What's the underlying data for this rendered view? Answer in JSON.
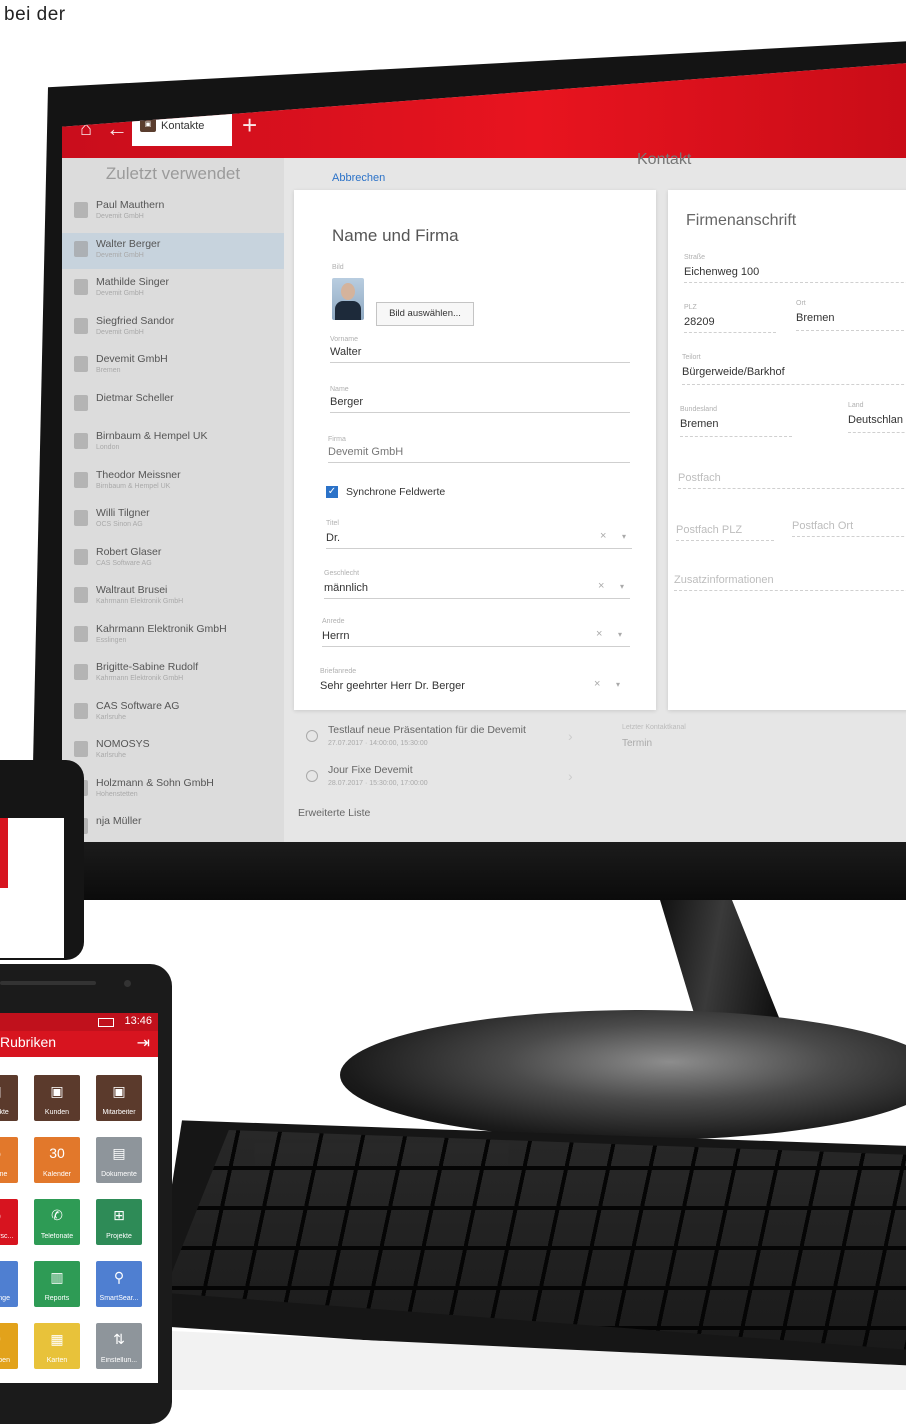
{
  "page_caption": "bei der",
  "app": {
    "tab_label": "Kontakte",
    "plus_label": "+",
    "home_icon": "home-icon",
    "back_icon": "arrow-left-icon",
    "left_title": "Zuletzt verwendet",
    "recent": [
      {
        "name": "Paul Mauthern",
        "sub": "Devemit GmbH"
      },
      {
        "name": "Walter Berger",
        "sub": "Devemit GmbH",
        "selected": true
      },
      {
        "name": "Mathilde Singer",
        "sub": "Devemit GmbH"
      },
      {
        "name": "Siegfried Sandor",
        "sub": "Devemit GmbH"
      },
      {
        "name": "Devemit GmbH",
        "sub": "Bremen"
      },
      {
        "name": "Dietmar Scheller",
        "sub": ""
      },
      {
        "name": "Birnbaum & Hempel UK",
        "sub": "London"
      },
      {
        "name": "Theodor Meissner",
        "sub": "Birnbaum & Hempel UK"
      },
      {
        "name": "Willi Tilgner",
        "sub": "OCS Sinon AG"
      },
      {
        "name": "Robert Glaser",
        "sub": "CAS Software AG"
      },
      {
        "name": "Waltraut Brusei",
        "sub": "Kahrmann Elektronik GmbH"
      },
      {
        "name": "Kahrmann Elektronik GmbH",
        "sub": "Esslingen"
      },
      {
        "name": "Brigitte-Sabine Rudolf",
        "sub": "Kahrmann Elektronik GmbH"
      },
      {
        "name": "CAS Software AG",
        "sub": "Karlsruhe"
      },
      {
        "name": "NOMOSYS",
        "sub": "Karlsruhe"
      },
      {
        "name": "Holzmann & Sohn GmbH",
        "sub": "Hohenstetten"
      },
      {
        "name": "nja Müller",
        "sub": ""
      }
    ],
    "center_title": "Kontakt",
    "cancel_label": "Abbrechen",
    "name_card": {
      "title": "Name und Firma",
      "photo_label": "Bild",
      "photo_button": "Bild auswählen...",
      "firstname_label": "Vorname",
      "firstname": "Walter",
      "lastname_label": "Name",
      "lastname": "Berger",
      "company_label": "Firma",
      "company": "Devemit GmbH",
      "sync_label": "Synchrone Feldwerte",
      "title_label": "Titel",
      "title_value": "Dr.",
      "gender_label": "Geschlecht",
      "gender_value": "männlich",
      "salutation_label": "Anrede",
      "salutation_value": "Herrn",
      "letter_salutation_label": "Briefanrede",
      "letter_salutation_value": "Sehr geehrter Herr Dr. Berger",
      "clear_glyph": "×",
      "dropdown_glyph": "▾"
    },
    "address_card": {
      "title": "Firmenanschrift",
      "street_label": "Straße",
      "street": "Eichenweg 100",
      "zip_label": "PLZ",
      "zip": "28209",
      "city_label": "Ort",
      "city": "Bremen",
      "district_label": "Teilort",
      "district": "Bürgerweide/Barkhof",
      "state_label": "Bundesland",
      "state": "Bremen",
      "country_label": "Land",
      "country": "Deutschlan",
      "pobox_placeholder": "Postfach",
      "pobox_zip_placeholder": "Postfach PLZ",
      "pobox_city_placeholder": "Postfach Ort",
      "extra_placeholder": "Zusatzinformationen"
    },
    "activities": [
      {
        "title": "Testlauf neue Präsentation für die Devemit",
        "sub": "27.07.2017 · 14:00:00, 15:30:00"
      },
      {
        "title": "Jour Fixe Devemit",
        "sub": "28.07.2017 · 15:30:00, 17:00:00"
      }
    ],
    "extended_list_label": "Erweiterte Liste",
    "last_contact_label": "Letzter Kontaktkanal",
    "last_contact_value": "Termin"
  },
  "phone": {
    "time": "13:46",
    "title": "Rubriken",
    "logout_icon": "logout-icon",
    "tiles": [
      {
        "label": "Kontakte",
        "icon": "contacts-icon",
        "glyph": "▣",
        "color": "#5b3a2c"
      },
      {
        "label": "Kunden",
        "icon": "customers-icon",
        "glyph": "▣",
        "color": "#5b3a2c"
      },
      {
        "label": "Mitarbeiter",
        "icon": "employees-icon",
        "glyph": "▣",
        "color": "#5b3a2c"
      },
      {
        "label": "Termine",
        "icon": "clock-icon",
        "glyph": "◷",
        "color": "#e2782b"
      },
      {
        "label": "Kalender",
        "icon": "calendar-icon",
        "glyph": "30",
        "color": "#e2782b"
      },
      {
        "label": "Dokumente",
        "icon": "document-icon",
        "glyph": "▤",
        "color": "#8e959b"
      },
      {
        "label": "Verkaufsc...",
        "icon": "sales-icon",
        "glyph": "◉",
        "color": "#d7141f"
      },
      {
        "label": "Telefonate",
        "icon": "phone-icon",
        "glyph": "✆",
        "color": "#2e9b55"
      },
      {
        "label": "Projekte",
        "icon": "projects-icon",
        "glyph": "⊞",
        "color": "#2e8b57"
      },
      {
        "label": "Vorgänge",
        "icon": "tasks-icon",
        "glyph": "✔",
        "color": "#4f7fd1"
      },
      {
        "label": "Reports",
        "icon": "chart-icon",
        "glyph": "▥",
        "color": "#2e9b55"
      },
      {
        "label": "SmartSear...",
        "icon": "search-icon",
        "glyph": "⚲",
        "color": "#4f7fd1"
      },
      {
        "label": "Aufgaben",
        "icon": "todo-icon",
        "glyph": "✚",
        "color": "#e2a21b"
      },
      {
        "label": "Karten",
        "icon": "map-icon",
        "glyph": "▦",
        "color": "#e8c23a"
      },
      {
        "label": "Einstellun...",
        "icon": "settings-icon",
        "glyph": "⇅",
        "color": "#8e959b"
      }
    ]
  }
}
